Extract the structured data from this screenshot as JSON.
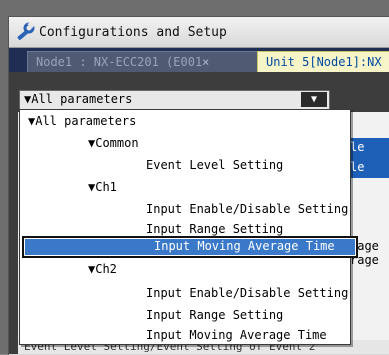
{
  "window": {
    "title": "Configurations and Setup"
  },
  "tabs": [
    {
      "label": "Node1 : NX-ECC201 (E001",
      "close": "×"
    },
    {
      "label": "Unit 5[Node1]:NX"
    }
  ],
  "dropdown": {
    "selected": "▼All parameters",
    "button": "▼"
  },
  "list": {
    "root": "▼All parameters",
    "groups": [
      {
        "label": "▼Common",
        "items": [
          "Event Level Setting"
        ]
      },
      {
        "label": "▼Ch1",
        "items": [
          "Input Enable/Disable Setting",
          "Input Range Setting",
          "Input Moving Average Time"
        ]
      },
      {
        "label": "▼Ch2",
        "items": [
          "Input Enable/Disable Setting",
          "Input Range Setting",
          "Input Moving Average Time"
        ]
      }
    ],
    "selected_item": "Input Moving Average Time"
  },
  "background": {
    "blue_row_1": "le",
    "blue_row_2": "le",
    "avg_row_1": "rage",
    "avg_row_2": "rage",
    "footer": "Event Level Setting/Event Setting of Event 2"
  },
  "colors": {
    "tab_active_bg": "#f7f5c8",
    "tab_active_text": "#004aa3",
    "selection": "#3a78c9"
  }
}
